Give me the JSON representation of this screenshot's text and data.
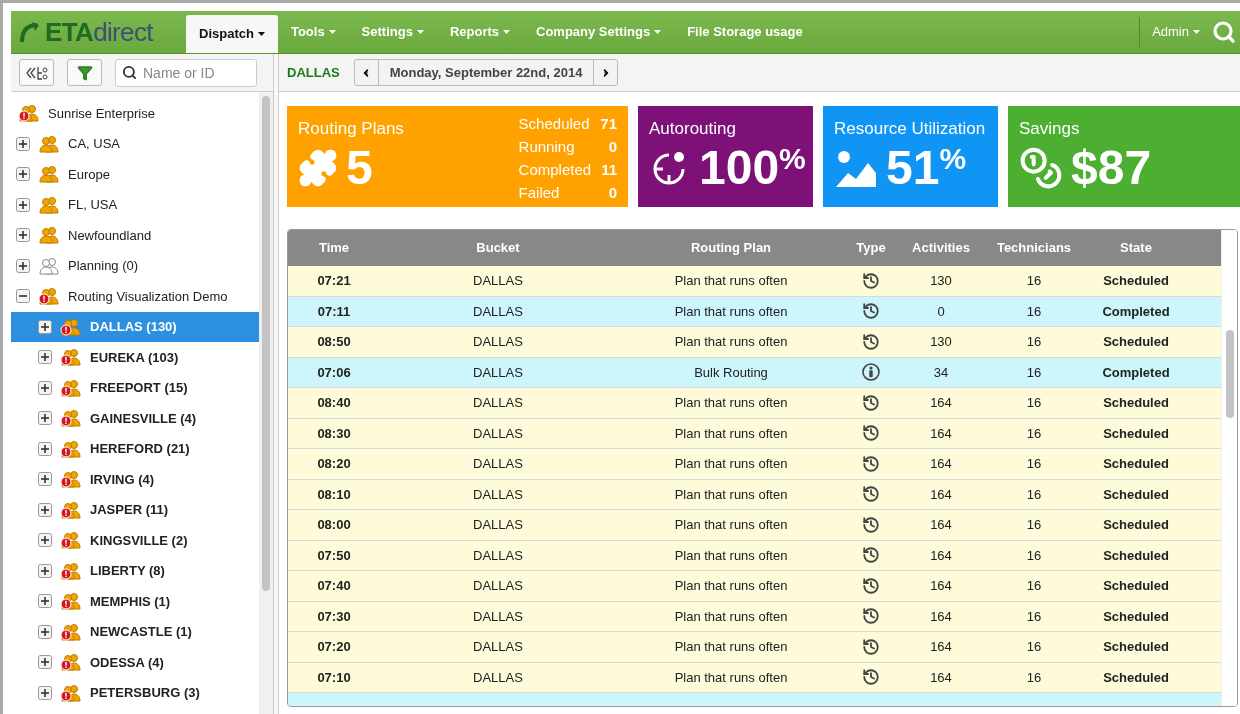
{
  "logo": {
    "part1": "ETA",
    "part2": "direct"
  },
  "nav": [
    {
      "label": "Dispatch",
      "selected": true,
      "dropdown": true
    },
    {
      "label": "Tools",
      "selected": false,
      "dropdown": true
    },
    {
      "label": "Settings",
      "selected": false,
      "dropdown": true
    },
    {
      "label": "Reports",
      "selected": false,
      "dropdown": true
    },
    {
      "label": "Company Settings",
      "selected": false,
      "dropdown": true
    },
    {
      "label": "File Storage usage",
      "selected": false,
      "dropdown": false
    }
  ],
  "user_menu": {
    "label": "Admin"
  },
  "sidebar": {
    "search": {
      "placeholder": "Name or ID"
    },
    "tree": [
      {
        "label": "Sunrise Enterprise",
        "kind": "alert",
        "selected": false,
        "children": [
          {
            "label": "CA, USA",
            "kind": "group",
            "expanded": false,
            "selected": false
          },
          {
            "label": "Europe",
            "kind": "group",
            "expanded": false,
            "selected": false
          },
          {
            "label": "FL, USA",
            "kind": "group",
            "expanded": false,
            "selected": false
          },
          {
            "label": "Newfoundland",
            "kind": "group",
            "expanded": false,
            "selected": false
          },
          {
            "label": "Planning (0)",
            "kind": "empty",
            "expanded": false,
            "selected": false
          },
          {
            "label": "Routing Visualization Demo",
            "kind": "alert",
            "expanded": true,
            "selected": false,
            "children": [
              {
                "label": "DALLAS (130)",
                "kind": "alert",
                "expanded": false,
                "selected": true
              },
              {
                "label": "EUREKA (103)",
                "kind": "alert",
                "expanded": false,
                "selected": false
              },
              {
                "label": "FREEPORT (15)",
                "kind": "alert",
                "expanded": false,
                "selected": false
              },
              {
                "label": "GAINESVILLE (4)",
                "kind": "alert",
                "expanded": false,
                "selected": false
              },
              {
                "label": "HEREFORD (21)",
                "kind": "alert",
                "expanded": false,
                "selected": false
              },
              {
                "label": "IRVING (4)",
                "kind": "alert",
                "expanded": false,
                "selected": false
              },
              {
                "label": "JASPER (11)",
                "kind": "alert",
                "expanded": false,
                "selected": false
              },
              {
                "label": "KINGSVILLE (2)",
                "kind": "alert",
                "expanded": false,
                "selected": false
              },
              {
                "label": "LIBERTY (8)",
                "kind": "alert",
                "expanded": false,
                "selected": false
              },
              {
                "label": "MEMPHIS (1)",
                "kind": "alert",
                "expanded": false,
                "selected": false
              },
              {
                "label": "NEWCASTLE (1)",
                "kind": "alert",
                "expanded": false,
                "selected": false
              },
              {
                "label": "ODESSA (4)",
                "kind": "alert",
                "expanded": false,
                "selected": false
              },
              {
                "label": "PETERSBURG (3)",
                "kind": "alert",
                "expanded": false,
                "selected": false
              }
            ]
          }
        ]
      }
    ]
  },
  "header": {
    "bucket": "DALLAS",
    "date": "Monday, September 22nd, 2014"
  },
  "tiles": [
    {
      "kind": "plans",
      "title": "Routing Plans",
      "value": "5",
      "color": "#ffa200",
      "stats": [
        {
          "label": "Scheduled",
          "value": "71"
        },
        {
          "label": "Running",
          "value": "0"
        },
        {
          "label": "Completed",
          "value": "11"
        },
        {
          "label": "Failed",
          "value": "0"
        }
      ]
    },
    {
      "kind": "autorouting",
      "title": "Autorouting",
      "value": "100",
      "unit": "%",
      "color": "#7e1178"
    },
    {
      "kind": "utilization",
      "title": "Resource Utilization",
      "value": "51",
      "unit": "%",
      "color": "#1195f5"
    },
    {
      "kind": "savings",
      "title": "Savings",
      "value": "$87",
      "color": "#4caf32"
    }
  ],
  "table": {
    "columns": [
      "Time",
      "Bucket",
      "Routing Plan",
      "Type",
      "Activities",
      "Technicians",
      "State"
    ],
    "rows": [
      {
        "time": "07:21",
        "bucket": "DALLAS",
        "plan": "Plan that runs often",
        "kind": "recurring",
        "activities": "130",
        "technicians": "16",
        "state": "Scheduled",
        "color": "#fdfbd9"
      },
      {
        "time": "07:11",
        "bucket": "DALLAS",
        "plan": "Plan that runs often",
        "kind": "recurring",
        "activities": "0",
        "technicians": "16",
        "state": "Completed",
        "color": "#cdf6fc"
      },
      {
        "time": "08:50",
        "bucket": "DALLAS",
        "plan": "Plan that runs often",
        "kind": "recurring",
        "activities": "130",
        "technicians": "16",
        "state": "Scheduled",
        "color": "#fdfbd9"
      },
      {
        "time": "07:06",
        "bucket": "DALLAS",
        "plan": "Bulk Routing",
        "kind": "bulk",
        "activities": "34",
        "technicians": "16",
        "state": "Completed",
        "color": "#cdf6fc"
      },
      {
        "time": "08:40",
        "bucket": "DALLAS",
        "plan": "Plan that runs often",
        "kind": "recurring",
        "activities": "164",
        "technicians": "16",
        "state": "Scheduled",
        "color": "#fdfbd9"
      },
      {
        "time": "08:30",
        "bucket": "DALLAS",
        "plan": "Plan that runs often",
        "kind": "recurring",
        "activities": "164",
        "technicians": "16",
        "state": "Scheduled",
        "color": "#fdfbd9"
      },
      {
        "time": "08:20",
        "bucket": "DALLAS",
        "plan": "Plan that runs often",
        "kind": "recurring",
        "activities": "164",
        "technicians": "16",
        "state": "Scheduled",
        "color": "#fdfbd9"
      },
      {
        "time": "08:10",
        "bucket": "DALLAS",
        "plan": "Plan that runs often",
        "kind": "recurring",
        "activities": "164",
        "technicians": "16",
        "state": "Scheduled",
        "color": "#fdfbd9"
      },
      {
        "time": "08:00",
        "bucket": "DALLAS",
        "plan": "Plan that runs often",
        "kind": "recurring",
        "activities": "164",
        "technicians": "16",
        "state": "Scheduled",
        "color": "#fdfbd9"
      },
      {
        "time": "07:50",
        "bucket": "DALLAS",
        "plan": "Plan that runs often",
        "kind": "recurring",
        "activities": "164",
        "technicians": "16",
        "state": "Scheduled",
        "color": "#fdfbd9"
      },
      {
        "time": "07:40",
        "bucket": "DALLAS",
        "plan": "Plan that runs often",
        "kind": "recurring",
        "activities": "164",
        "technicians": "16",
        "state": "Scheduled",
        "color": "#fdfbd9"
      },
      {
        "time": "07:30",
        "bucket": "DALLAS",
        "plan": "Plan that runs often",
        "kind": "recurring",
        "activities": "164",
        "technicians": "16",
        "state": "Scheduled",
        "color": "#fdfbd9"
      },
      {
        "time": "07:20",
        "bucket": "DALLAS",
        "plan": "Plan that runs often",
        "kind": "recurring",
        "activities": "164",
        "technicians": "16",
        "state": "Scheduled",
        "color": "#fdfbd9"
      },
      {
        "time": "07:10",
        "bucket": "DALLAS",
        "plan": "Plan that runs often",
        "kind": "recurring",
        "activities": "164",
        "technicians": "16",
        "state": "Scheduled",
        "color": "#fdfbd9"
      }
    ]
  }
}
